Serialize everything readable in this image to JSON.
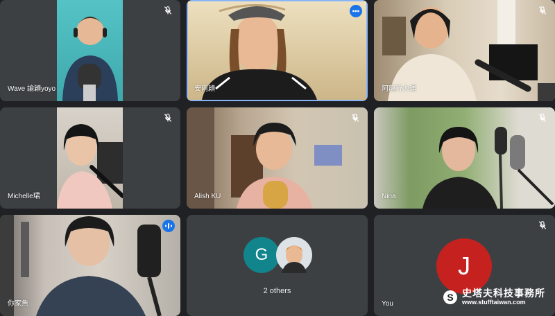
{
  "participants": [
    {
      "name": "Wave 諭穎yoyo",
      "muted": true
    },
    {
      "name": "安雨穎",
      "muted": false,
      "active": true
    },
    {
      "name": "阿龍行大運",
      "muted": true
    },
    {
      "name": "Michelle珺",
      "muted": true
    },
    {
      "name": "Alish KU",
      "muted": true
    },
    {
      "name": "Nina",
      "muted": true
    },
    {
      "name": "你家魚",
      "muted": false,
      "speaking": true
    },
    {
      "name": "2 others",
      "avatar_letter": "G"
    },
    {
      "name": "You",
      "avatar_letter": "J",
      "muted": true
    }
  ],
  "watermark": {
    "title": "史塔夫科技事務所",
    "url": "www.stufftaiwan.com"
  },
  "colors": {
    "background": "#202124",
    "tile": "#3c4043",
    "accent": "#1a73e8",
    "avatar_g": "#12858c",
    "avatar_j": "#c5221f"
  },
  "icons": {
    "mic_off": "mic-off-icon",
    "more": "more-vert-icon",
    "speaking": "audio-level-icon"
  }
}
